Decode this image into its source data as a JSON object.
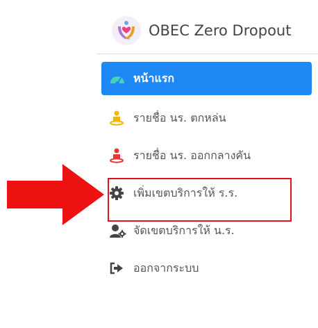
{
  "app": {
    "title": "OBEC Zero Dropout"
  },
  "nav": {
    "items": [
      {
        "label": "หน้าแรก",
        "icon": "dashboard-icon",
        "active": true
      },
      {
        "label": "รายชื่อ นร. ตกหล่น",
        "icon": "student-icon-yellow"
      },
      {
        "label": "รายชื่อ นร. ออกกลางคัน",
        "icon": "student-icon-red"
      },
      {
        "label": "เพิ่มเขตบริการให้ ร.ร.",
        "icon": "gear-icon"
      },
      {
        "label": "จัดเขตบริการให้ น.ร.",
        "icon": "user-gear-icon"
      },
      {
        "label": "ออกจากระบบ",
        "icon": "sign-out-icon"
      }
    ]
  },
  "colors": {
    "active": "#1e88f5",
    "highlight": "#e0101d",
    "arrow": "#ee1111"
  }
}
